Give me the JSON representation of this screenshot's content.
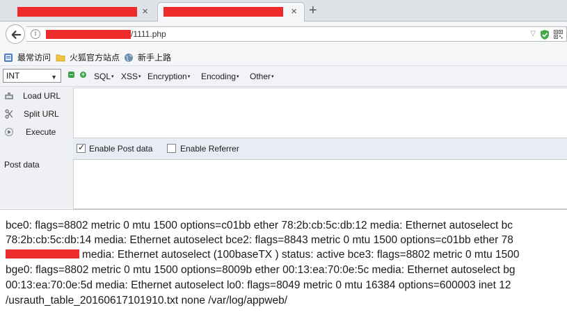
{
  "tabs": [
    {
      "state": "inactive",
      "title": "",
      "close": "×"
    },
    {
      "state": "active",
      "title": "",
      "close": "×"
    }
  ],
  "new_tab": "+",
  "address": {
    "url_suffix": "/1111.php",
    "dropdown": "▽"
  },
  "bookmarks": [
    {
      "label": "最常访问",
      "icon": "bookmark-icon"
    },
    {
      "label": "火狐官方站点",
      "icon": "folder-icon"
    },
    {
      "label": "新手上路",
      "icon": "globe-icon"
    }
  ],
  "hackbar": {
    "select_value": "INT",
    "menus": [
      "SQL",
      "XSS",
      "Encryption",
      "Encoding",
      "Other"
    ],
    "actions": [
      {
        "label": "Load URL",
        "icon": "load-url-icon"
      },
      {
        "label": "Split URL",
        "icon": "split-url-icon"
      },
      {
        "label": "Execute",
        "icon": "execute-icon"
      }
    ],
    "enable_post": {
      "label": "Enable Post data",
      "checked": true
    },
    "enable_referrer": {
      "label": "Enable Referrer",
      "checked": false
    },
    "post_label": "Post data"
  },
  "colors": {
    "redaction": "#ee2b2b",
    "accent_green": "#3aa348"
  },
  "output_lines": [
    "bce0: flags=8802 metric 0 mtu 1500 options=c01bb ether 78:2b:cb:5c:db:12 media: Ethernet autoselect bc",
    "78:2b:cb:5c:db:14 media: Ethernet autoselect bce2: flags=8843 metric 0 mtu 1500 options=c01bb ether 78",
    "media: Ethernet autoselect (100baseTX ) status: active bce3: flags=8802 metric 0 mtu 1500",
    "bge0: flags=8802 metric 0 mtu 1500 options=8009b ether 00:13:ea:70:0e:5c media: Ethernet autoselect bg",
    "00:13:ea:70:0e:5d media: Ethernet autoselect lo0: flags=8049 metric 0 mtu 16384 options=600003 inet 12",
    "/usrauth_table_20160617101910.txt none /var/log/appweb/"
  ]
}
